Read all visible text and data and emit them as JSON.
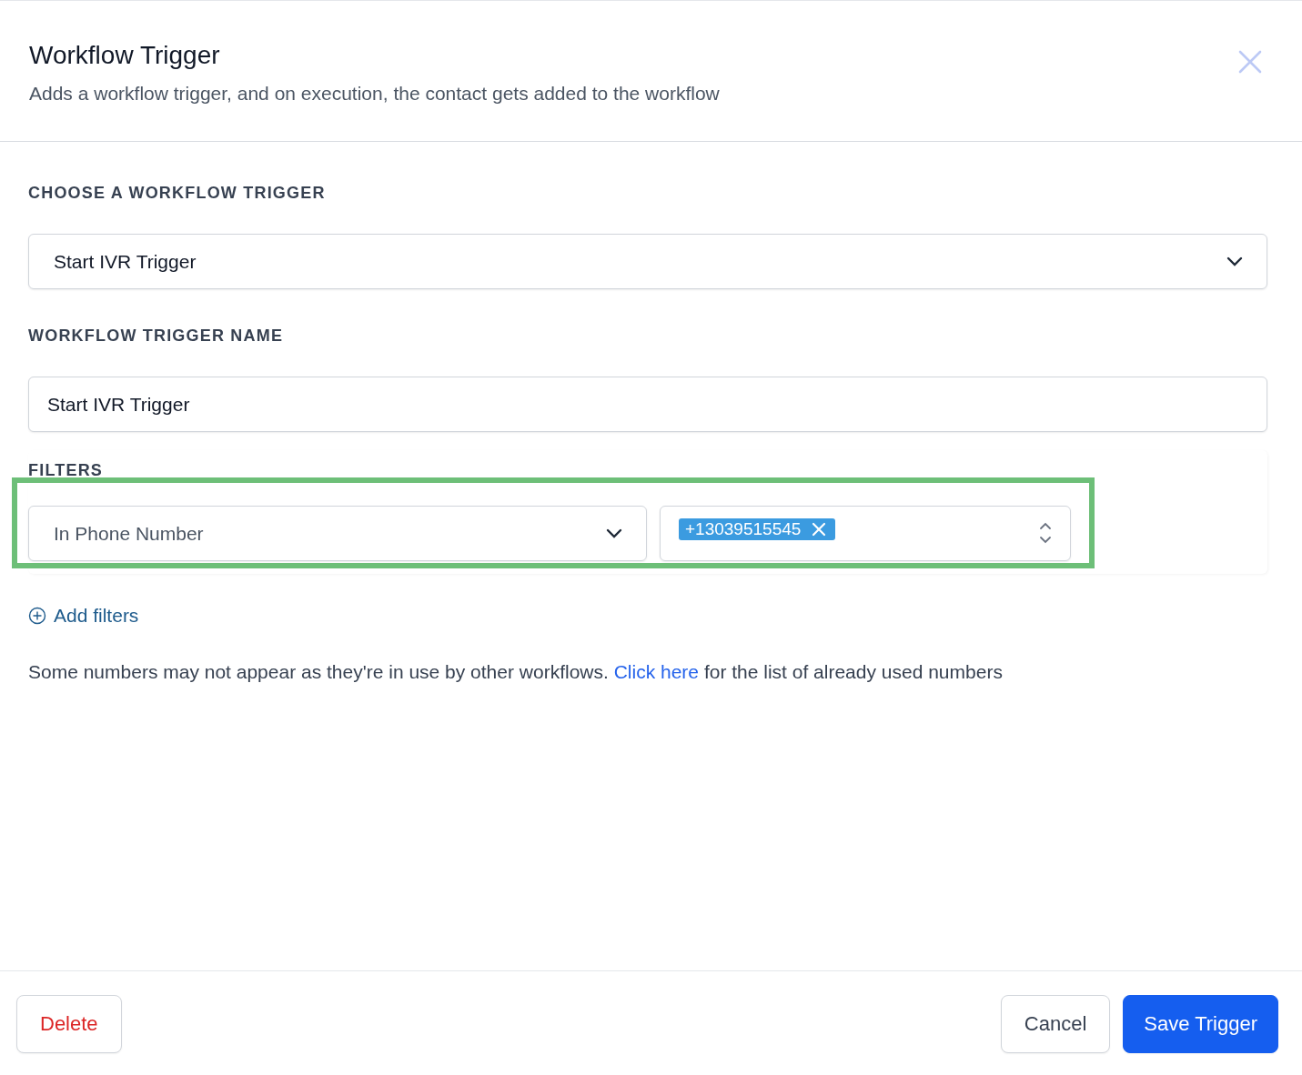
{
  "dialog": {
    "title": "Workflow Trigger",
    "subtitle": "Adds a workflow trigger, and on execution, the contact gets added to the workflow"
  },
  "trigger_section": {
    "label": "CHOOSE A WORKFLOW TRIGGER",
    "value": "Start IVR Trigger"
  },
  "name_section": {
    "label": "WORKFLOW TRIGGER NAME",
    "value": "Start IVR Trigger"
  },
  "filters": {
    "label": "FILTERS",
    "field": "In Phone Number",
    "highlighted": true,
    "tags": [
      {
        "label": "+13039515545"
      }
    ]
  },
  "add_filters": "Add filters",
  "note": {
    "before": "Some numbers may not appear as they're in use by other workflows.",
    "link": "Click here",
    "after": "for the list of already used numbers"
  },
  "buttons": [
    {
      "label": "Delete",
      "kind": "danger"
    },
    {
      "label": "Cancel",
      "kind": "secondary"
    },
    {
      "label": "Save Trigger",
      "kind": "primary"
    }
  ]
}
